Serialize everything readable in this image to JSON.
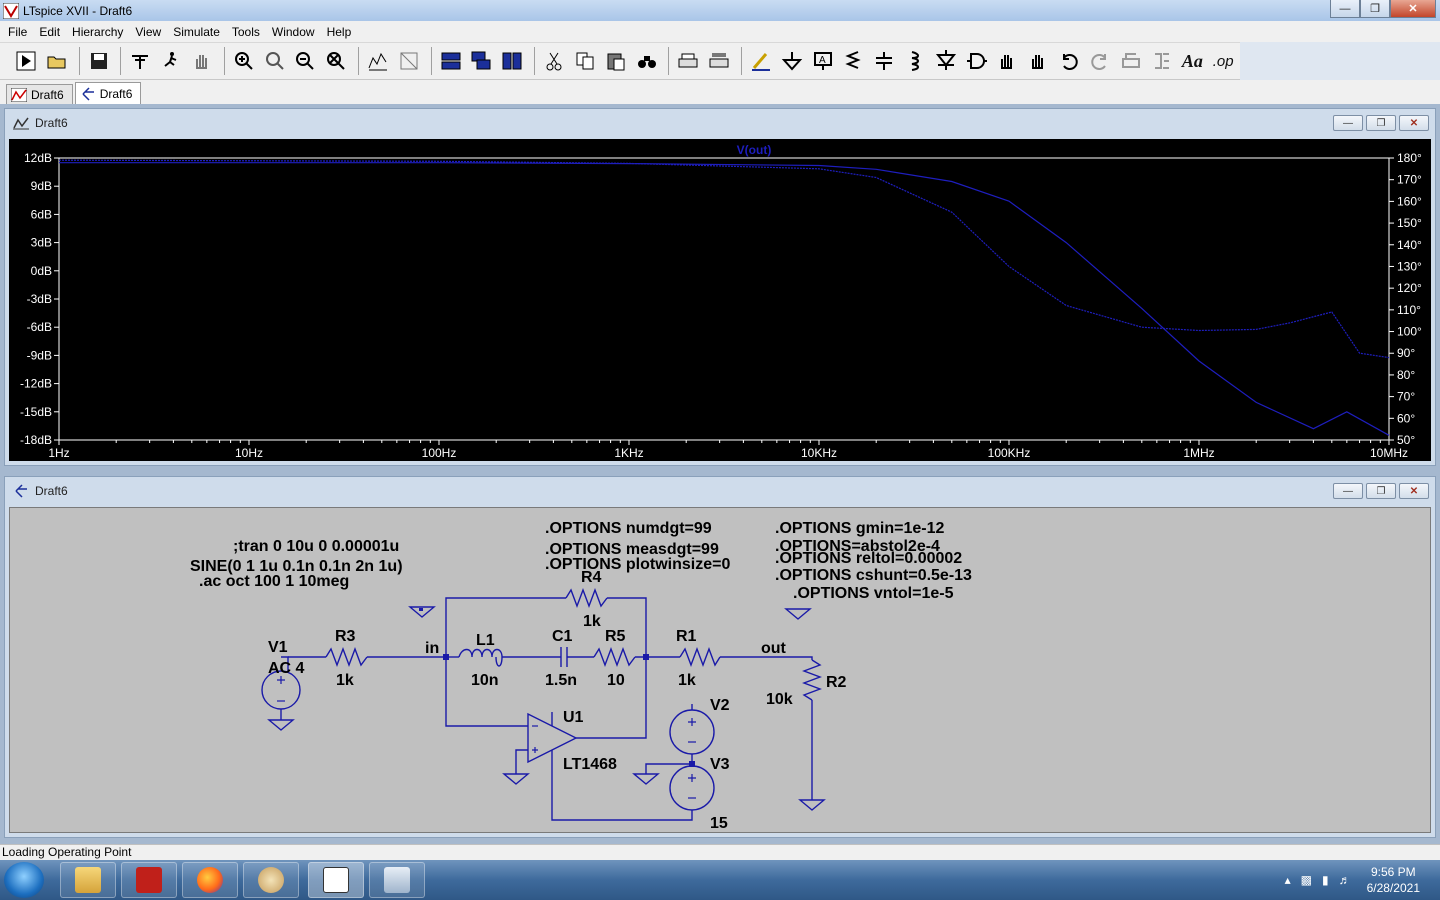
{
  "window": {
    "title": "LTspice XVII - Draft6"
  },
  "menu": [
    "File",
    "Edit",
    "Hierarchy",
    "View",
    "Simulate",
    "Tools",
    "Window",
    "Help"
  ],
  "toolbar_icons": [
    "run-icon",
    "open-icon",
    "save-icon",
    "control-panel-icon",
    "halt-icon",
    "pan-icon",
    "zoom-in-icon",
    "zoom-area-icon",
    "zoom-out-icon",
    "zoom-cancel-icon",
    "autorange-icon",
    "fit-icon",
    "tile-horizontal-icon",
    "cascade-icon",
    "tile-vertical-icon",
    "cut-icon",
    "copy-icon",
    "paste-icon",
    "find-icon",
    "print-icon",
    "print-preview-icon",
    "wire-icon",
    "ground-icon",
    "label-icon",
    "resistor-icon",
    "capacitor-icon",
    "inductor-icon",
    "diode-icon",
    "component-icon",
    "move-icon",
    "drag-icon",
    "undo-icon",
    "redo-icon",
    "rotate-icon",
    "mirror-icon",
    "text-icon",
    "spice-directive-icon"
  ],
  "toolbar_texts": {
    "text": "Aa",
    "op": ".op"
  },
  "tabs": [
    {
      "label": "Draft6",
      "kind": "waveform"
    },
    {
      "label": "Draft6",
      "kind": "schematic"
    }
  ],
  "plot_window": {
    "title": "Draft6"
  },
  "schematic_window": {
    "title": "Draft6"
  },
  "chart_data": {
    "type": "line",
    "title": "V(out)",
    "xscale": "log",
    "xlim": [
      1,
      10000000
    ],
    "x_ticks": [
      "1Hz",
      "10Hz",
      "100Hz",
      "1KHz",
      "10KHz",
      "100KHz",
      "1MHz",
      "10MHz"
    ],
    "y_left_ticks": [
      "12dB",
      "9dB",
      "6dB",
      "3dB",
      "0dB",
      "-3dB",
      "-6dB",
      "-9dB",
      "-12dB",
      "-15dB",
      "-18dB"
    ],
    "y_left_lim": [
      -18,
      12
    ],
    "y_right_ticks": [
      "180°",
      "170°",
      "160°",
      "150°",
      "140°",
      "130°",
      "120°",
      "110°",
      "100°",
      "90°",
      "80°",
      "70°",
      "60°",
      "50°"
    ],
    "y_right_lim": [
      50,
      180
    ],
    "grid": false,
    "colors": {
      "trace": "#1e1ebe",
      "background": "#000000",
      "axis": "#ffffff"
    },
    "series": [
      {
        "axis": "left",
        "x": [
          1,
          100,
          1000,
          10000,
          20000,
          50000,
          100000,
          200000,
          500000,
          1000000,
          2000000,
          4000000,
          6000000,
          10000000
        ],
        "values": [
          11.5,
          11.5,
          11.4,
          11.2,
          10.8,
          9.5,
          7.4,
          3.0,
          -4.0,
          -9.6,
          -14.0,
          -16.8,
          -15.0,
          -17.5
        ]
      },
      {
        "axis": "right",
        "x": [
          1,
          100,
          1000,
          10000,
          20000,
          50000,
          100000,
          200000,
          500000,
          1000000,
          2000000,
          3000000,
          5000000,
          7000000,
          10000000
        ],
        "values": [
          179,
          178.5,
          177.5,
          175,
          171,
          155,
          130,
          112,
          102,
          100.5,
          101,
          104,
          109,
          90,
          88
        ]
      }
    ]
  },
  "schematic": {
    "directives": {
      "tran": ";tran 0 10u 0 0.00001u",
      "sine": "SINE(0 1 1u 0.1n 0.1n 2n 1u)",
      "ac": ".ac oct 100 1 10meg",
      "opt1": ".OPTIONS numdgt=99",
      "opt2": ".OPTIONS measdgt=99",
      "opt3": ".OPTIONS plotwinsize=0",
      "opt4": ".OPTIONS gmin=1e-12",
      "opt5": ".OPTIONS=abstol2e-4",
      "opt6": ".OPTIONS reltol=0.00002",
      "opt7": ".OPTIONS cshunt=0.5e-13",
      "opt8": ".OPTIONS vntol=1e-5"
    },
    "components": {
      "v1_name": "V1",
      "v1_value": "AC 4",
      "r3_name": "R3",
      "r3_value": "1k",
      "net_in": "in",
      "l1_name": "L1",
      "l1_value": "10n",
      "c1_name": "C1",
      "c1_value": "1.5n",
      "r5_name": "R5",
      "r5_value": "10",
      "r4_name": "R4",
      "r4_value": "1k",
      "r1_name": "R1",
      "r1_value": "1k",
      "net_out": "out",
      "r2_name": "R2",
      "r2_value": "10k",
      "u1_name": "U1",
      "u1_value": "LT1468",
      "v2_name": "V2",
      "v3_name": "V3",
      "v3_value": "15"
    }
  },
  "status": {
    "text": "Loading Operating Point"
  },
  "taskbar": {
    "apps": [
      "file-explorer-icon",
      "acrobat-icon",
      "firefox-icon",
      "paint-icon",
      "ltspice-icon",
      "calculator-icon"
    ],
    "time": "9:56 PM",
    "date": "6/28/2021"
  }
}
